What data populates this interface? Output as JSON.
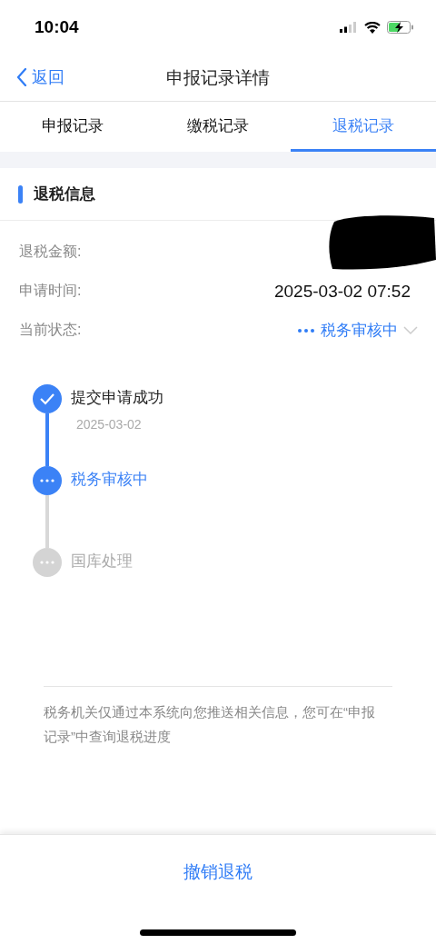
{
  "status_bar": {
    "time": "10:04"
  },
  "nav": {
    "back": "返回",
    "title": "申报记录详情"
  },
  "tabs": [
    {
      "label": "申报记录",
      "selected": false
    },
    {
      "label": "缴税记录",
      "selected": false
    },
    {
      "label": "退税记录",
      "selected": true
    }
  ],
  "section": {
    "title": "退税信息"
  },
  "fields": [
    {
      "label": "退税金额:",
      "kind": "redacted"
    },
    {
      "label": "申请时间:",
      "kind": "text",
      "value": "2025-03-02 07:52"
    },
    {
      "label": "当前状态:",
      "kind": "status",
      "value": "税务审核中",
      "expanded": false
    }
  ],
  "timeline": [
    {
      "title": "提交申请成功",
      "kind": "done",
      "date": "2025-03-02"
    },
    {
      "title": "税务审核中",
      "kind": "current"
    },
    {
      "title": "国库处理",
      "kind": "pending"
    }
  ],
  "note": "税务机关仅通过本系统向您推送相关信息，您可在“申报记录”中查询退税进度",
  "action": {
    "label": "撤销退税"
  }
}
